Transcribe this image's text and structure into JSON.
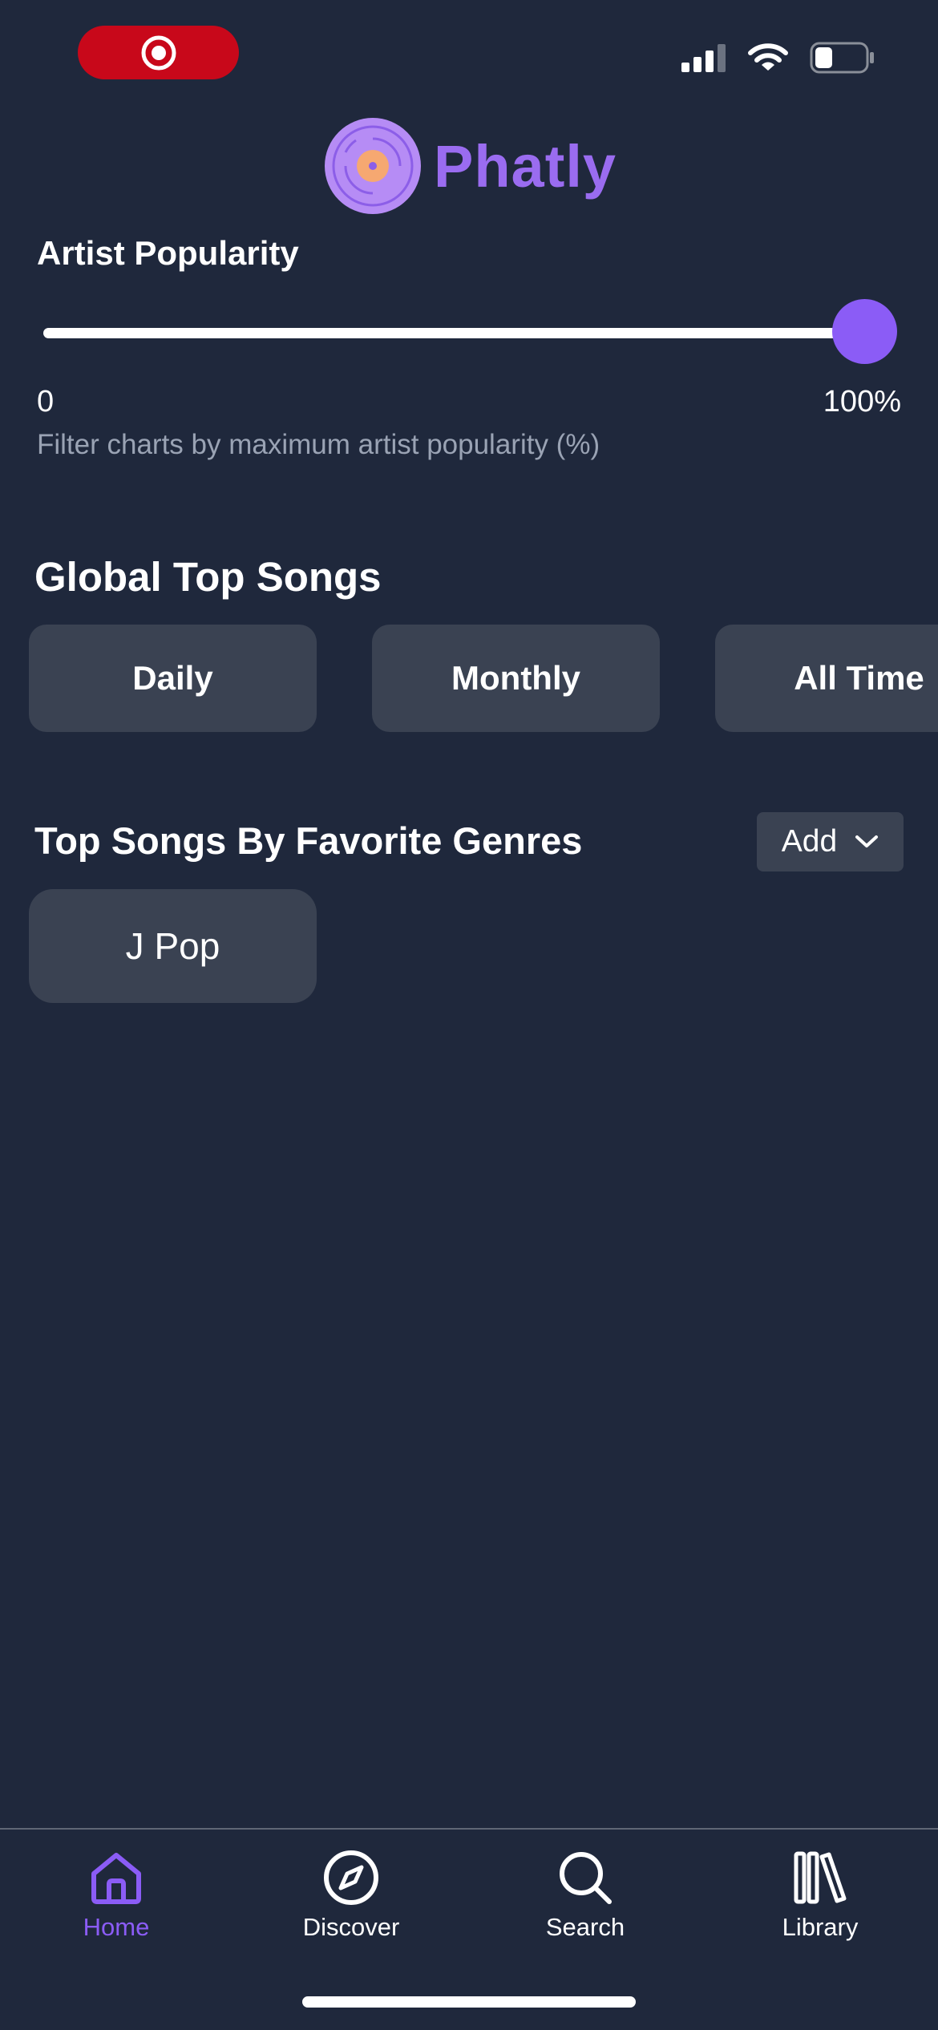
{
  "status_bar": {
    "recording_icon": "record-icon",
    "signal_icon": "cellular-signal-icon",
    "wifi_icon": "wifi-icon",
    "battery_icon": "battery-icon",
    "battery_level": 0.35
  },
  "header": {
    "logo_icon": "vinyl-record-icon",
    "app_name": "Phatly",
    "brand_color": "#9a6cf0"
  },
  "popularity_filter": {
    "label": "Artist Popularity",
    "min_label": "0",
    "max_label": "100%",
    "value_percent": 100,
    "help_text": "Filter charts by maximum artist popularity (%)",
    "accent_color": "#8b5cf6"
  },
  "global_top_songs": {
    "title": "Global Top Songs",
    "periods": [
      "Daily",
      "Monthly",
      "All Time"
    ]
  },
  "genres": {
    "title": "Top Songs By Favorite Genres",
    "add_label": "Add",
    "add_icon": "chevron-down-icon",
    "items": [
      "J Pop"
    ]
  },
  "tab_bar": {
    "active_color": "#8b5cf6",
    "tabs": [
      {
        "label": "Home",
        "icon": "home-icon",
        "active": true
      },
      {
        "label": "Discover",
        "icon": "compass-icon",
        "active": false
      },
      {
        "label": "Search",
        "icon": "search-icon",
        "active": false
      },
      {
        "label": "Library",
        "icon": "library-icon",
        "active": false
      }
    ]
  }
}
